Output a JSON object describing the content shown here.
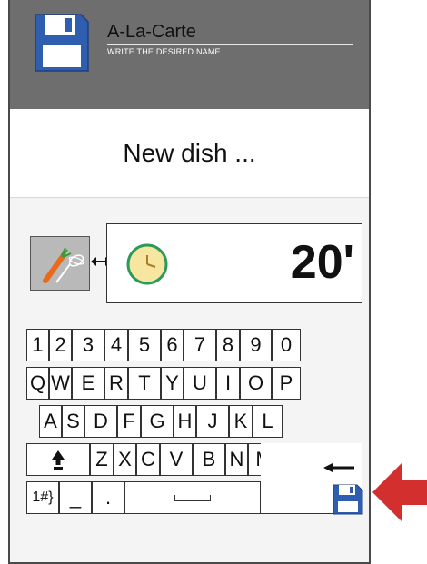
{
  "header": {
    "title": "A-La-Carte",
    "subtitle": "WRITE THE DESIRED NAME",
    "background": "#6e6e6e",
    "icon": "floppy-disk-icon"
  },
  "input": {
    "dish_name": "New dish ..."
  },
  "timer": {
    "tool_icon": "whisk-carrot-icon",
    "clock_icon": "clock-icon",
    "value": "20'"
  },
  "keyboard": {
    "row1": [
      "1",
      "2",
      "3",
      "4",
      "5",
      "6",
      "7",
      "8",
      "9",
      "0"
    ],
    "row2": [
      "Q",
      "W",
      "E",
      "R",
      "T",
      "Y",
      "U",
      "I",
      "O",
      "P"
    ],
    "row3": [
      "A",
      "S",
      "D",
      "F",
      "G",
      "H",
      "J",
      "K",
      "L"
    ],
    "row4": [
      "Z",
      "X",
      "C",
      "V",
      "B",
      "N",
      "M"
    ],
    "symbols": "1#}",
    "underscore": "_",
    "dot": ".",
    "shift_icon": "shift-up-arrow-icon",
    "backspace_icon": "backspace-arrow-icon",
    "save_icon": "floppy-disk-icon"
  },
  "colors": {
    "floppy_blue": "#2f5db0",
    "pointer_red": "#d32f2f",
    "clock_face": "#f6e6a0",
    "clock_ring": "#2d9a5a"
  }
}
